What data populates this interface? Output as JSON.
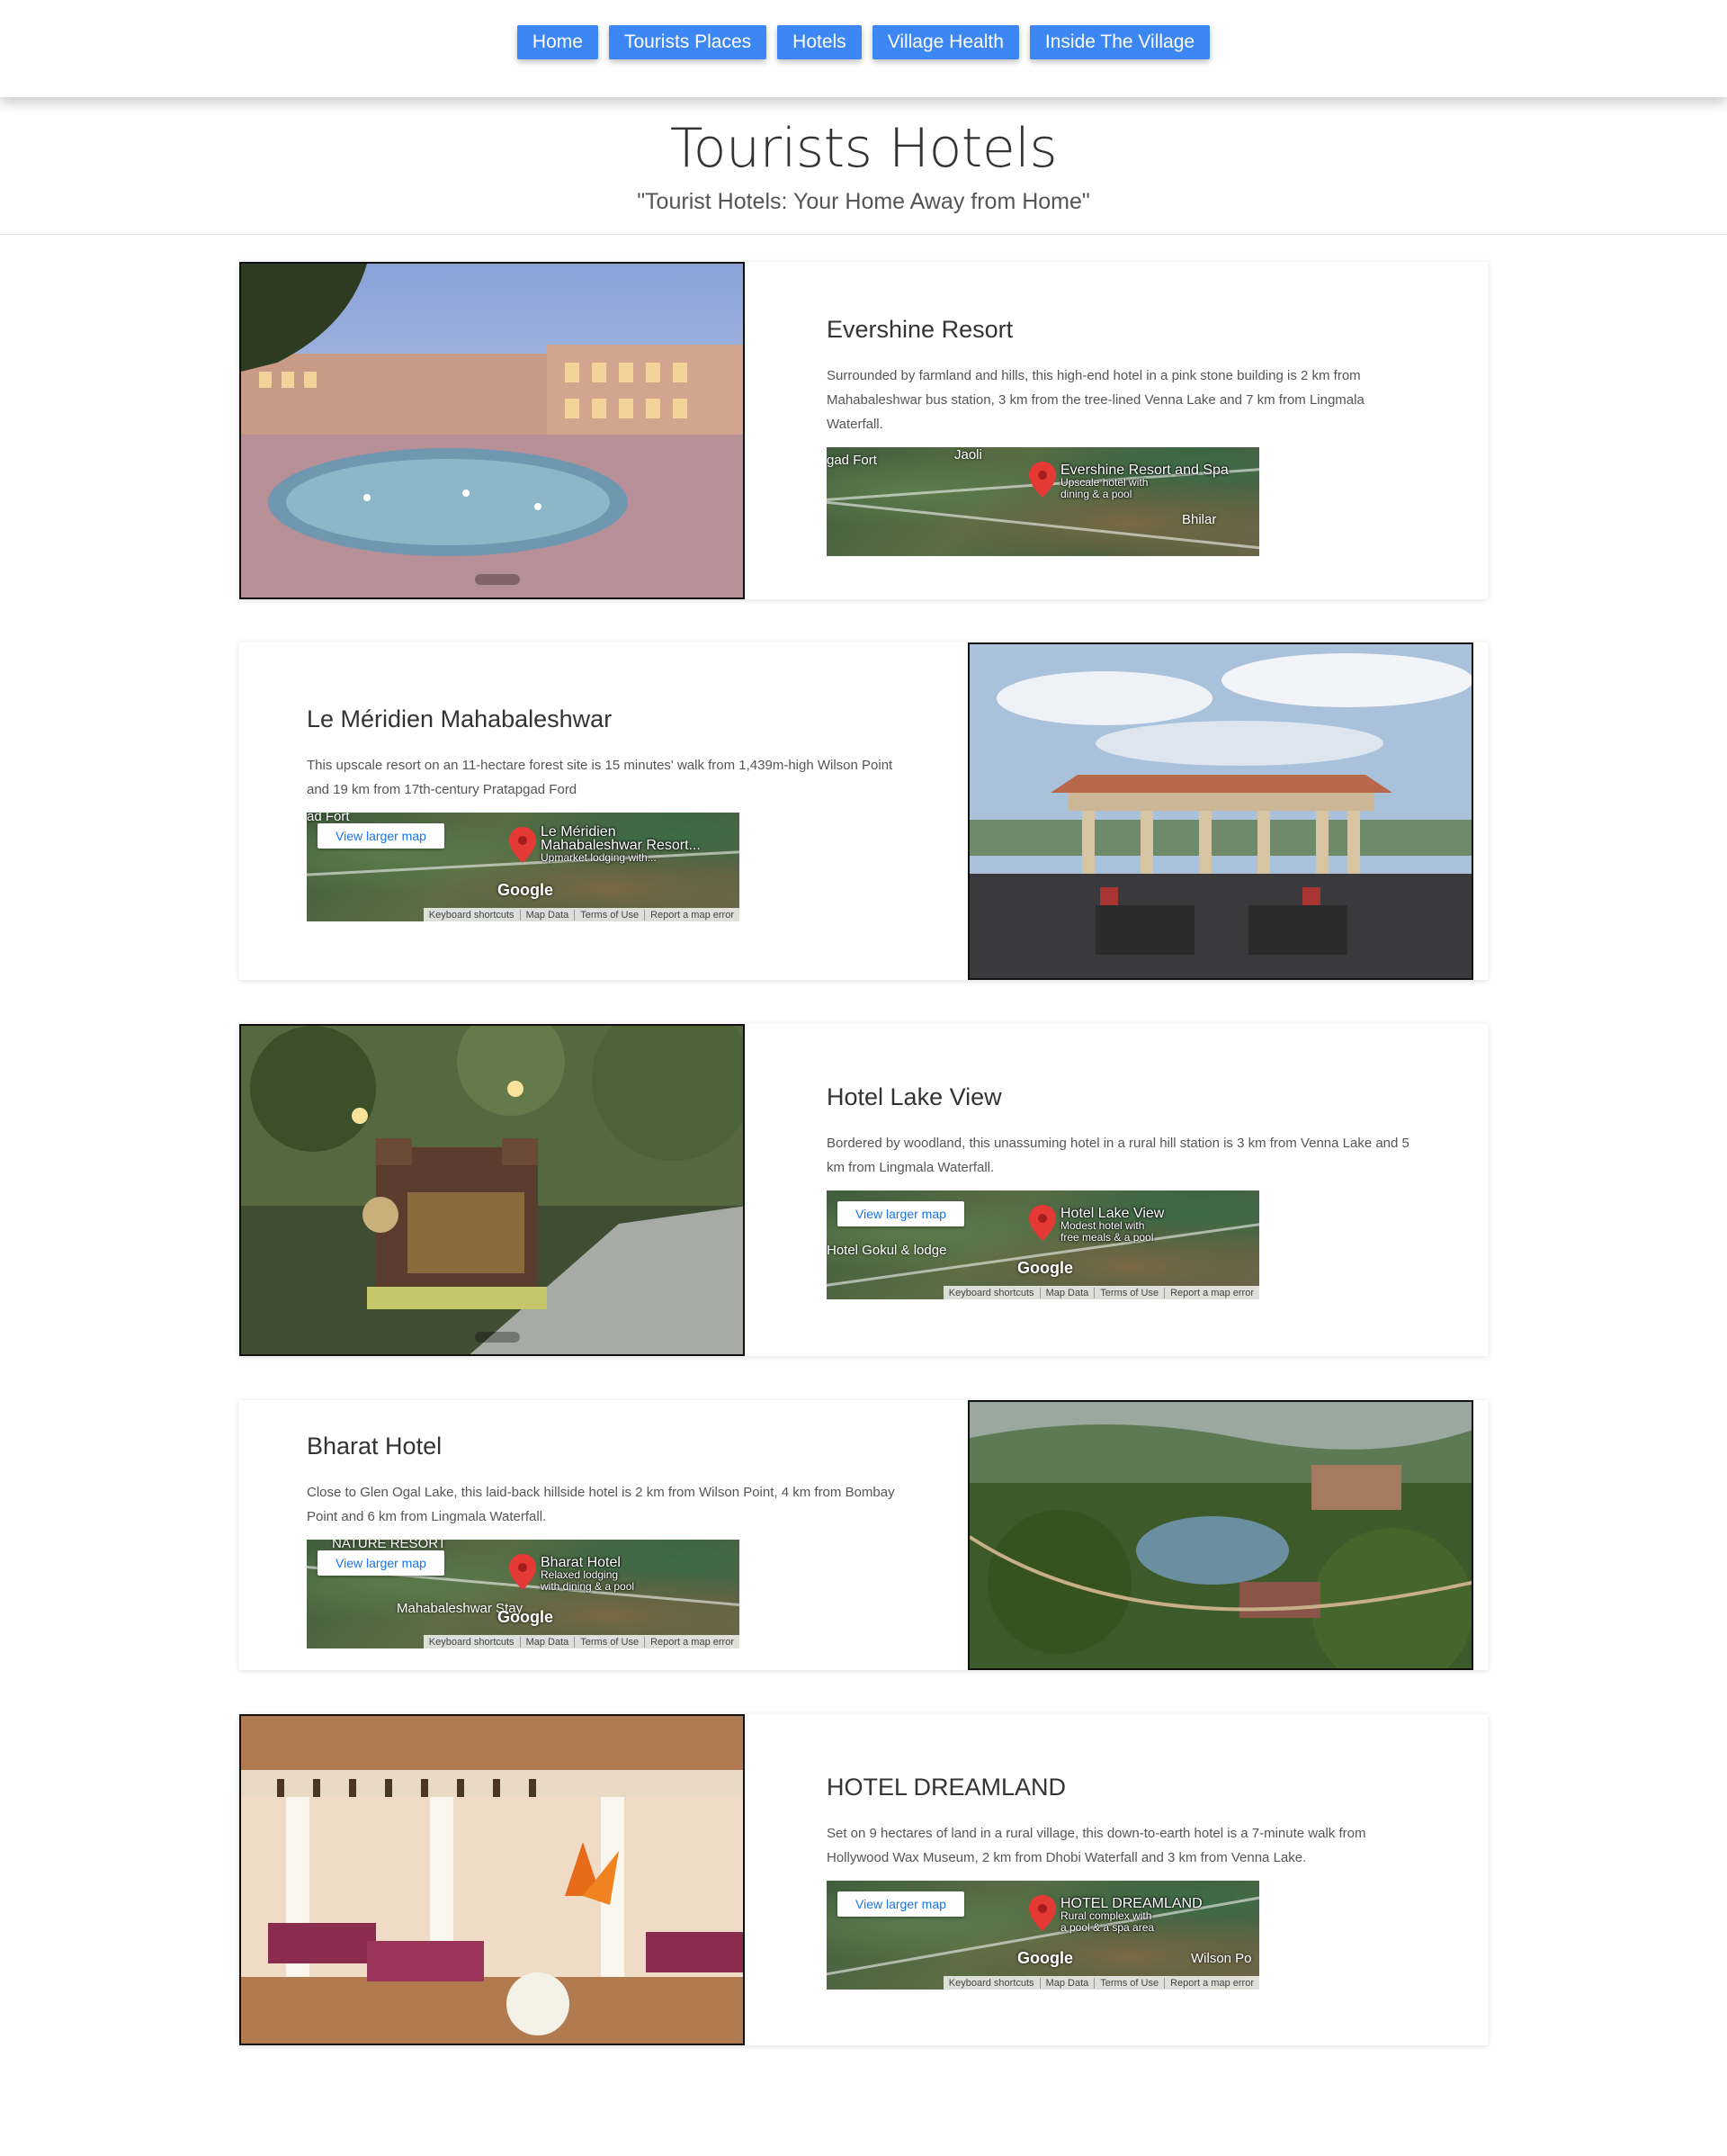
{
  "nav": {
    "items": [
      "Home",
      "Tourists Places",
      "Hotels",
      "Village Health",
      "Inside The Village"
    ]
  },
  "header": {
    "title": "Tourists Hotels",
    "subtitle": "\"Tourist Hotels: Your Home Away from Home\""
  },
  "map_common": {
    "view_larger": "View larger map",
    "google": "Google",
    "footer": [
      "Keyboard shortcuts",
      "Map Data",
      "Terms of Use",
      "Report a map error"
    ]
  },
  "hotels": [
    {
      "name": "Evershine Resort",
      "description": "Surrounded by farmland and hills, this high-end hotel in a pink stone building is 2 km from Mahabaleshwar bus station, 3 km from the tree-lined Venna Lake and 7 km from Lingmala Waterfall.",
      "map": {
        "place_name": "Evershine Resort and Spa",
        "place_detail1": "Upscale hotel with",
        "place_detail2": "dining & a pool",
        "other_label1": "gad Fort",
        "other_label2": "Jaoli",
        "other_label3": "Bhilar"
      }
    },
    {
      "name": "Le Méridien Mahabaleshwar",
      "description": "This upscale resort on an 11-hectare forest site is 15 minutes' walk from 1,439m-high Wilson Point and 19 km from 17th-century Pratapgad Ford",
      "map": {
        "place_name": "Le Méridien",
        "place_name2": "Mahabaleshwar Resort...",
        "place_detail1": "Upmarket lodging with...",
        "other_label1": "ad Fort"
      }
    },
    {
      "name": "Hotel Lake View",
      "description": "Bordered by woodland, this unassuming hotel in a rural hill station is 3 km from Venna Lake and 5 km from Lingmala Waterfall.",
      "map": {
        "place_name": "Hotel Lake View",
        "place_detail1": "Modest hotel with",
        "place_detail2": "free meals & a pool",
        "other_label1": "Hotel Gokul & lodge"
      }
    },
    {
      "name": "Bharat Hotel",
      "description": "Close to Glen Ogal Lake, this laid-back hillside hotel is 2 km from Wilson Point, 4 km from Bombay Point and 6 km from Lingmala Waterfall.",
      "map": {
        "place_name": "Bharat Hotel",
        "place_detail1": "Relaxed lodging",
        "place_detail2": "with dining & a pool",
        "other_label1": "NATURE RESORT",
        "other_label2": "Mahabaleshwar Stay"
      }
    },
    {
      "name": "HOTEL DREAMLAND",
      "description": "Set on 9 hectares of land in a rural village, this down-to-earth hotel is a 7-minute walk from Hollywood Wax Museum, 2 km from Dhobi Waterfall and 3 km from Venna Lake.",
      "map": {
        "place_name": "HOTEL DREAMLAND",
        "place_detail1": "Rural complex with",
        "place_detail2": "a pool & a spa area",
        "other_label1": "Wilson Po"
      }
    }
  ]
}
